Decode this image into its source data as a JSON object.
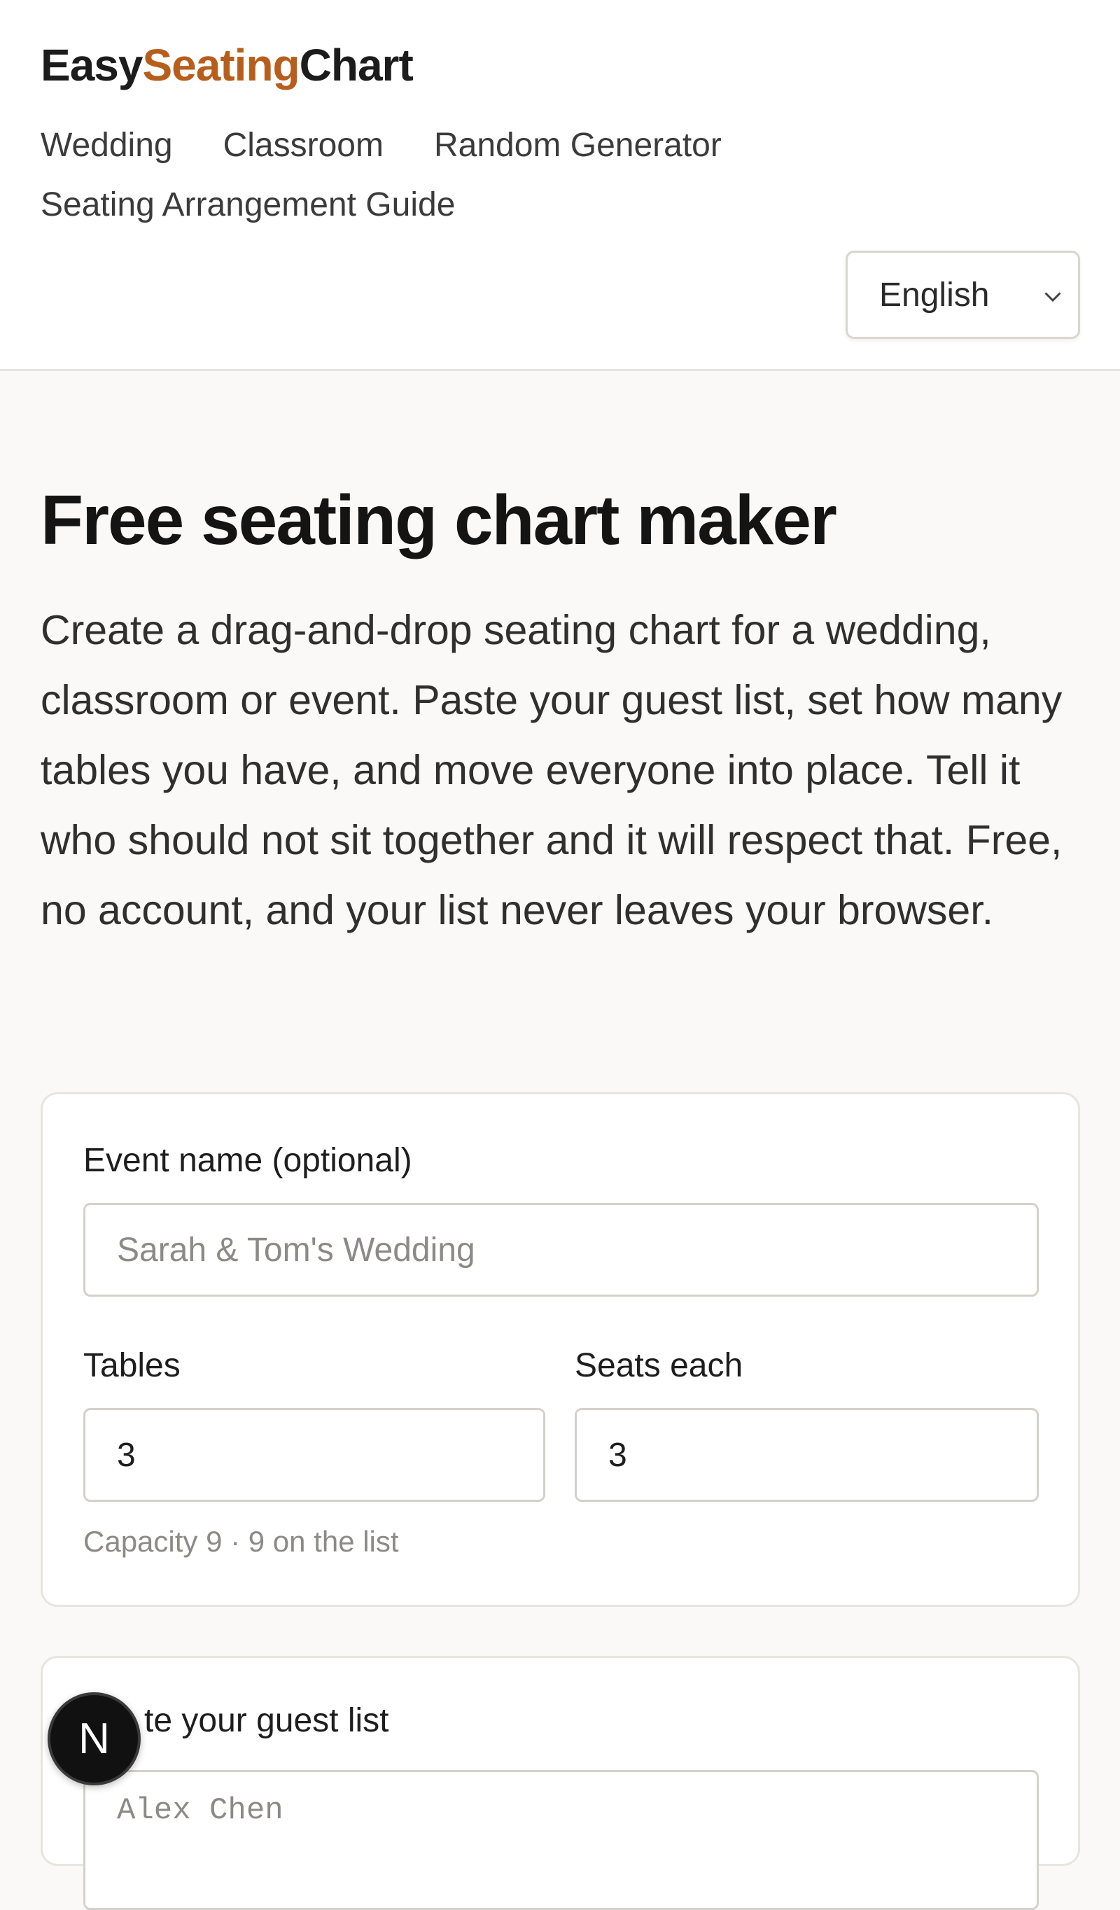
{
  "brand": {
    "part1": "Easy",
    "part2": "Seating",
    "part3": "Chart"
  },
  "nav": {
    "items": [
      "Wedding",
      "Classroom",
      "Random Generator",
      "Seating Arrangement Guide"
    ]
  },
  "language": {
    "selected": "English",
    "icon": "chevron-down-icon"
  },
  "hero": {
    "title": "Free seating chart maker",
    "description": "Create a drag-and-drop seating chart for a wedding, classroom or event. Paste your guest list, set how many tables you have, and move everyone into place. Tell it who should not sit together and it will respect that. Free, no account, and your list never leaves your browser."
  },
  "setup": {
    "event_label": "Event name (optional)",
    "event_placeholder": "Sarah & Tom's Wedding",
    "tables_label": "Tables",
    "tables_value": "3",
    "seats_label": "Seats each",
    "seats_value": "3",
    "capacity_text": "Capacity 9 · 9 on the list"
  },
  "guests": {
    "label_visible": "te your guest list",
    "placeholder": "Alex Chen"
  },
  "dev_badge": {
    "letter": "N"
  },
  "colors": {
    "accent": "#b85e1c",
    "background": "#faf9f7",
    "card": "#ffffff"
  }
}
